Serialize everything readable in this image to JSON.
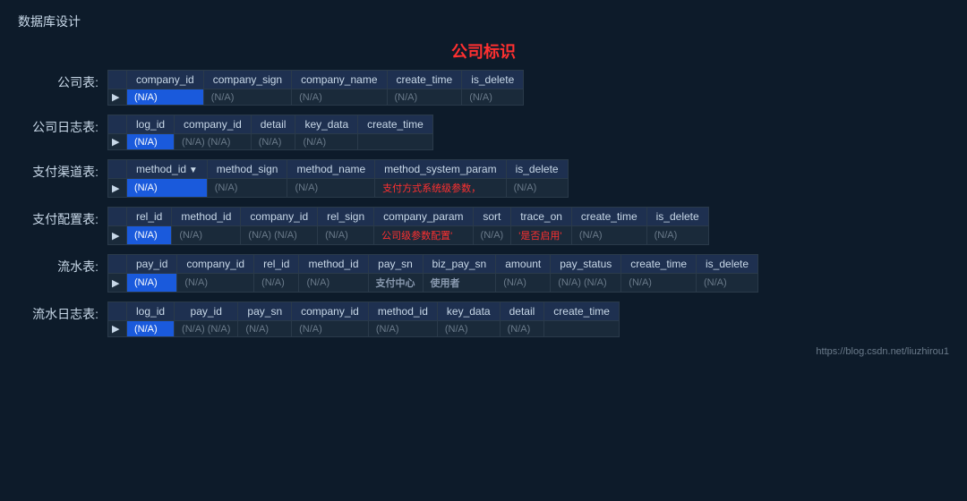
{
  "page": {
    "title": "数据库设计",
    "center_title": "公司标识",
    "footer_url": "https://blog.csdn.net/liuzhirou1"
  },
  "tables": [
    {
      "label": "公司表:",
      "columns": [
        "company_id",
        "company_sign",
        "company_name",
        "create_time",
        "is_delete"
      ],
      "rows": [
        {
          "arrow": "▶",
          "cells": [
            "(N/A)",
            "(N/A)",
            "(N/A)",
            "(N/A)",
            "(N/A)"
          ],
          "highlighted": [
            0
          ]
        }
      ]
    },
    {
      "label": "公司日志表:",
      "columns": [
        "log_id",
        "company_id",
        "detail",
        "key_data",
        "create_time"
      ],
      "rows": [
        {
          "arrow": "▶",
          "cells": [
            "(N/A)",
            "(N/A)  (N/A)",
            "(N/A)",
            "(N/A)",
            ""
          ],
          "highlighted": [
            0
          ]
        }
      ]
    },
    {
      "label": "支付渠道表:",
      "columns": [
        "method_id",
        "method_sign",
        "method_name",
        "method_system_param",
        "is_delete"
      ],
      "column_arrow": [
        0
      ],
      "rows": [
        {
          "arrow": "▶",
          "cells": [
            "(N/A)",
            "(N/A)",
            "(N/A)",
            "支付方式系统级参数，",
            "(N/A)"
          ],
          "highlighted": [
            0
          ],
          "comment": [
            3
          ]
        }
      ]
    },
    {
      "label": "支付配置表:",
      "columns": [
        "rel_id",
        "method_id",
        "company_id",
        "rel_sign",
        "company_param",
        "sort",
        "trace_on",
        "create_time",
        "is_delete"
      ],
      "rows": [
        {
          "arrow": "▶",
          "cells": [
            "(N/A)",
            "(N/A)",
            "(N/A)  (N/A)",
            "(N/A)",
            "公司级参数配置'",
            "(N/A)",
            "'是否启用'",
            "(N/A)",
            "(N/A)"
          ],
          "highlighted": [
            0
          ],
          "comment": [
            4,
            6
          ]
        }
      ]
    },
    {
      "label": "流水表:",
      "columns": [
        "pay_id",
        "company_id",
        "rel_id",
        "method_id",
        "pay_sn",
        "biz_pay_sn",
        "amount",
        "pay_status",
        "create_time",
        "is_delete"
      ],
      "rows": [
        {
          "arrow": "▶",
          "cells": [
            "(N/A)",
            "(N/A)",
            "(N/A)",
            "(N/A)",
            "支付中心",
            "使用者",
            "(N/A)",
            "(N/A)  (N/A)",
            "(N/A)",
            "(N/A)"
          ],
          "highlighted": [
            0
          ],
          "red": [
            4,
            5
          ]
        }
      ]
    },
    {
      "label": "流水日志表:",
      "columns": [
        "log_id",
        "pay_id",
        "pay_sn",
        "company_id",
        "method_id",
        "key_data",
        "detail",
        "create_time"
      ],
      "rows": [
        {
          "arrow": "▶",
          "cells": [
            "(N/A)",
            "(N/A)  (N/A)",
            "(N/A)",
            "(N/A)",
            "(N/A)",
            "(N/A)",
            "(N/A)",
            ""
          ],
          "highlighted": [
            0
          ]
        }
      ]
    }
  ]
}
